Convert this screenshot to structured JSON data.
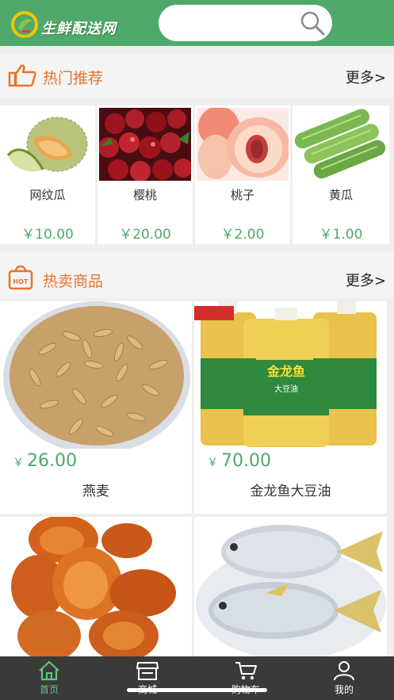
{
  "header": {
    "logo_text": "生鲜配送网",
    "search_placeholder": ""
  },
  "recommend": {
    "title": "热门推荐",
    "more": "更多>",
    "items": [
      {
        "name": "网纹瓜",
        "price": "￥10.00"
      },
      {
        "name": "樱桃",
        "price": "￥20.00"
      },
      {
        "name": "桃子",
        "price": "￥2.00"
      },
      {
        "name": "黄瓜",
        "price": "￥1.00"
      }
    ]
  },
  "hot": {
    "title": "热卖商品",
    "more": "更多>",
    "badge": "HOT",
    "items": [
      {
        "name": "燕麦",
        "currency": "￥",
        "price": "26.00"
      },
      {
        "name": "金龙鱼大豆油",
        "currency": "￥",
        "price": "70.00",
        "label": "金龙鱼",
        "sublabel": "大豆油"
      },
      {
        "name": "",
        "currency": "",
        "price": ""
      },
      {
        "name": "",
        "currency": "",
        "price": ""
      }
    ]
  },
  "tabs": [
    {
      "label": "首页",
      "icon": "home-icon",
      "active": true
    },
    {
      "label": "商城",
      "icon": "store-icon",
      "active": false
    },
    {
      "label": "购物车",
      "icon": "cart-icon",
      "active": false
    },
    {
      "label": "我的",
      "icon": "user-icon",
      "active": false
    }
  ],
  "colors": {
    "brand_green": "#4ea96a",
    "accent_orange": "#e8732a",
    "tabbar_bg": "#3a3a3a",
    "active_tab": "#5cc97d"
  }
}
